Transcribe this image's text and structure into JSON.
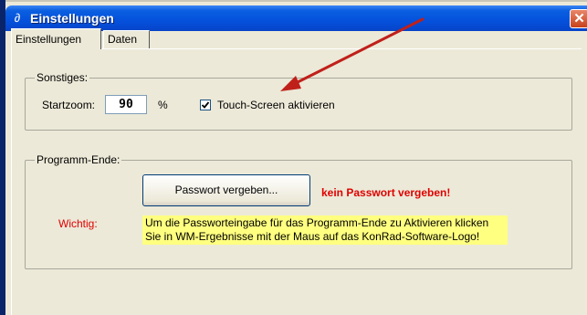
{
  "window": {
    "title": "Einstellungen",
    "close_glyph": "✕"
  },
  "tabs": [
    {
      "label": "Einstellungen",
      "active": true
    },
    {
      "label": "Daten",
      "active": false
    }
  ],
  "sonstiges": {
    "legend": "Sonstiges:",
    "startzoom_label": "Startzoom:",
    "startzoom_value": "90",
    "startzoom_unit": "%",
    "touch_label": "Touch-Screen aktivieren",
    "touch_checked": true
  },
  "programm_ende": {
    "legend": "Programm-Ende:",
    "password_button": "Passwort vergeben...",
    "password_status": "kein Passwort vergeben!",
    "wichtig_label": "Wichtig:",
    "note_line1": "Um die Passworteingabe für das Programm-Ende zu Aktivieren klicken",
    "note_line2": "Sie in WM-Ergebnisse mit der Maus auf das KonRad-Software-Logo!"
  },
  "colors": {
    "titlebar": "#0551dc",
    "warning_red": "#e00000",
    "note_yellow": "#ffff80",
    "annotation_arrow": "#c0201a"
  },
  "icons": {
    "app": "app-icon",
    "close": "close-icon",
    "checkmark": "checkmark-icon"
  }
}
